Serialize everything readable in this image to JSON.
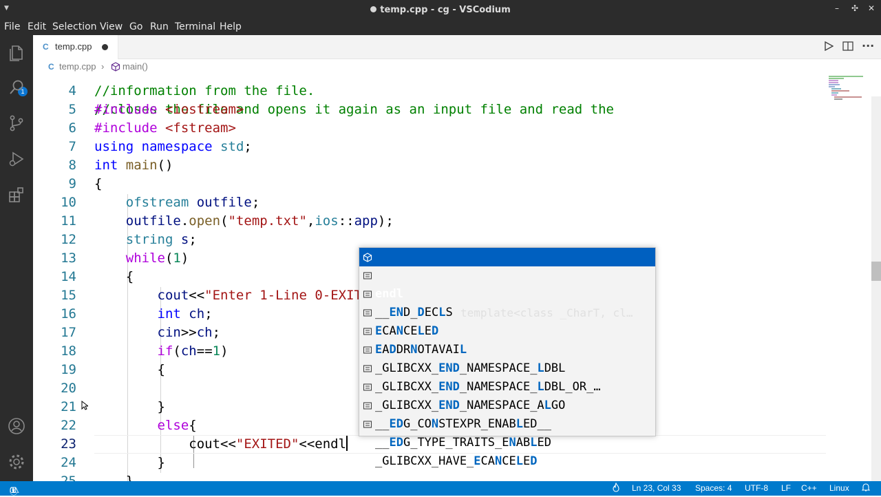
{
  "window": {
    "title": "temp.cpp - cg - VSCodium",
    "minimize": "–",
    "restore": "✣",
    "close": "✕"
  },
  "menu": [
    "File",
    "Edit",
    "Selection",
    "View",
    "Go",
    "Run",
    "Terminal",
    "Help"
  ],
  "activity": {
    "explorer_badge": "1"
  },
  "tab": {
    "icon": "C",
    "label": "temp.cpp",
    "dirty": true
  },
  "breadcrumb": {
    "file_icon": "C",
    "file": "temp.cpp",
    "sep": "›",
    "symbol": "main()"
  },
  "editor": {
    "line_numbers": [
      "4",
      "5",
      "6",
      "7",
      "8",
      "9",
      "10",
      "11",
      "12",
      "13",
      "14",
      "15",
      "16",
      "17",
      "18",
      "19",
      "20",
      "21",
      "22",
      "23",
      "24",
      "25"
    ],
    "partial_top_line": "//closes the file and opens it again as an input file and read the"
  },
  "suggest": {
    "items": [
      {
        "label": "endl",
        "detail": "template<class _CharT, cl…",
        "icon": "cube-icon"
      },
      {
        "label": "__END_DECLS",
        "icon": "list-icon"
      },
      {
        "label": "ECANCELED",
        "icon": "list-icon"
      },
      {
        "label": "EADDRNOTAVAIL",
        "icon": "list-icon"
      },
      {
        "label": "_GLIBCXX_END_NAMESPACE_LDBL",
        "icon": "list-icon"
      },
      {
        "label": "_GLIBCXX_END_NAMESPACE_LDBL_OR_…",
        "icon": "list-icon"
      },
      {
        "label": "_GLIBCXX_END_NAMESPACE_ALGO",
        "icon": "list-icon"
      },
      {
        "label": "__EDG_CONSTEXPR_ENABLED__",
        "icon": "list-icon"
      },
      {
        "label": "__EDG_TYPE_TRAITS_ENABLED",
        "icon": "list-icon"
      },
      {
        "label": "_GLIBCXX_HAVE_ECANCELED",
        "icon": "list-icon"
      }
    ]
  },
  "status": {
    "errors": "0",
    "warnings": "0",
    "position": "Ln 23, Col 33",
    "spaces": "Spaces: 4",
    "encoding": "UTF-8",
    "eol": "LF",
    "language": "C++",
    "platform": "Linux"
  },
  "colors": {
    "accent": "#007acc",
    "selection": "#0060c0",
    "chrome": "#2c2c2c"
  }
}
